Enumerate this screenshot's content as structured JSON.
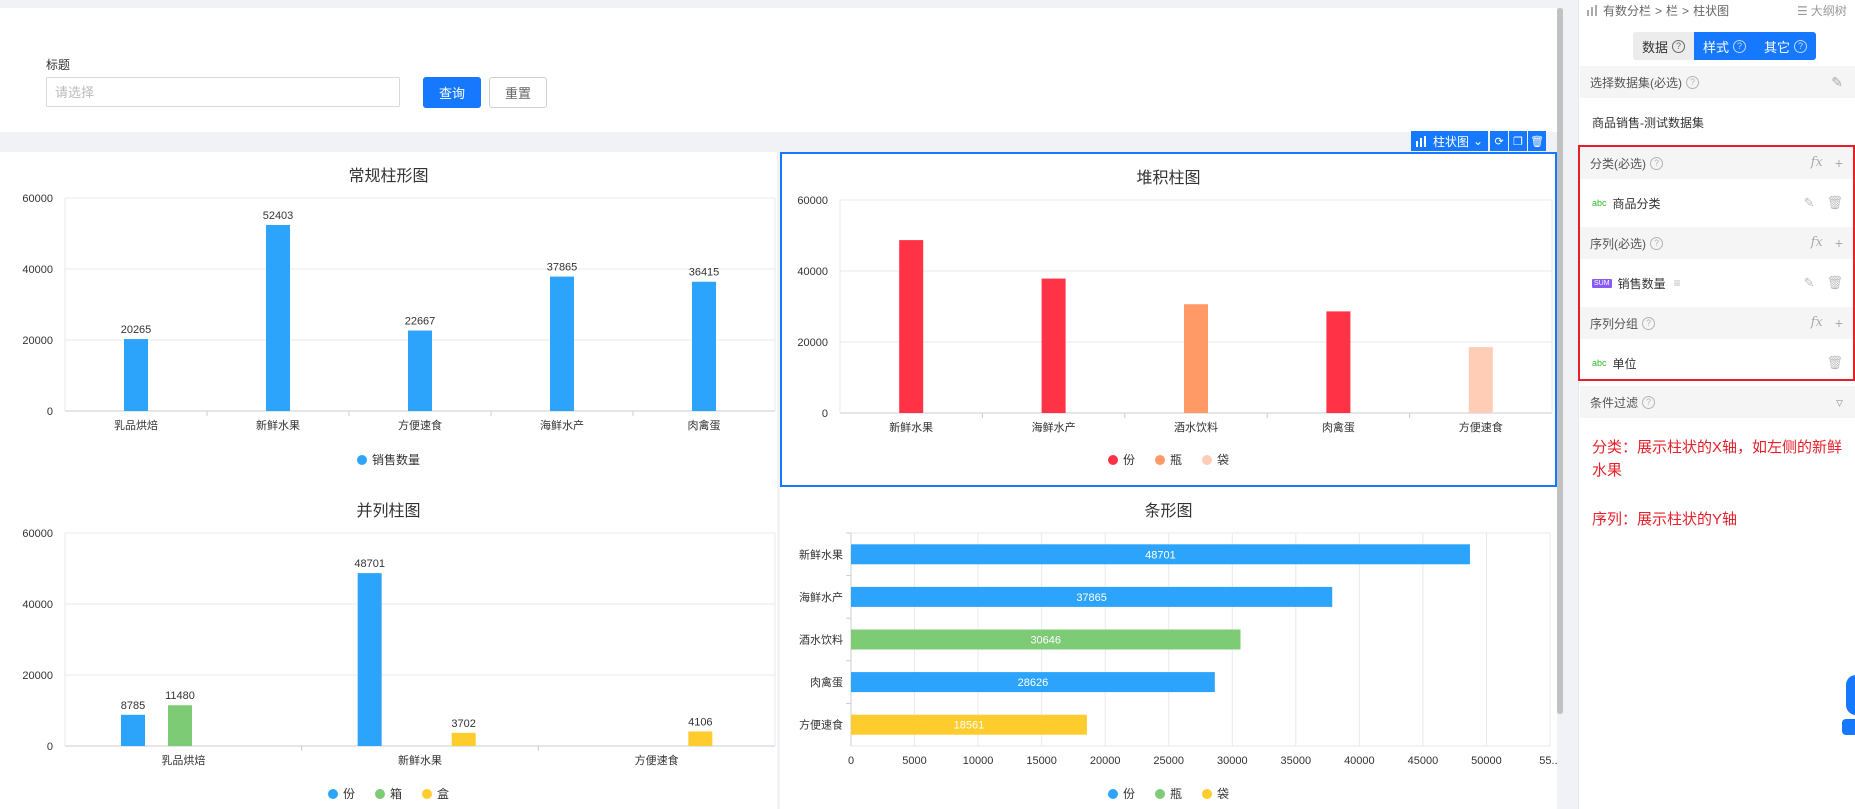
{
  "filter": {
    "label": "标题",
    "placeholder": "请选择",
    "query_label": "查询",
    "reset_label": "重置"
  },
  "toolbar": {
    "chart_type_label": "柱状图",
    "icons": [
      "bar-chart-icon",
      "chevron-down-icon",
      "refresh-icon",
      "copy-icon",
      "delete-icon"
    ]
  },
  "chart_data": [
    {
      "id": "regular",
      "type": "bar",
      "title": "常规柱形图",
      "categories": [
        "乳品烘焙",
        "新鲜水果",
        "方便速食",
        "海鲜水产",
        "肉禽蛋"
      ],
      "series": [
        {
          "name": "销售数量",
          "color": "#2da4fc",
          "values": [
            20265,
            52403,
            22667,
            37865,
            36415
          ]
        }
      ],
      "ylim": [
        0,
        60000
      ],
      "yticks": [
        0,
        20000,
        40000,
        60000
      ],
      "data_labels": true,
      "grid": true,
      "legend": "bottom-center"
    },
    {
      "id": "stacked",
      "type": "bar",
      "title": "堆积柱图",
      "categories": [
        "新鲜水果",
        "海鲜水产",
        "酒水饮料",
        "肉禽蛋",
        "方便速食"
      ],
      "bars": [
        {
          "category": "新鲜水果",
          "series": "份",
          "value": 48701
        },
        {
          "category": "海鲜水产",
          "series": "份",
          "value": 37865
        },
        {
          "category": "酒水饮料",
          "series": "瓶",
          "value": 30646
        },
        {
          "category": "肉禽蛋",
          "series": "份",
          "value": 28626
        },
        {
          "category": "方便速食",
          "series": "袋",
          "value": 18561
        }
      ],
      "series": [
        {
          "name": "份",
          "color": "#ff3345"
        },
        {
          "name": "瓶",
          "color": "#ff9966"
        },
        {
          "name": "袋",
          "color": "#ffcdb5"
        }
      ],
      "ylim": [
        0,
        60000
      ],
      "yticks": [
        0,
        20000,
        40000,
        60000
      ],
      "grid": true,
      "legend": "bottom-center"
    },
    {
      "id": "grouped",
      "type": "bar",
      "title": "并列柱图",
      "categories": [
        "乳品烘焙",
        "新鲜水果",
        "方便速食"
      ],
      "series": [
        {
          "name": "份",
          "color": "#2da4fc",
          "values": [
            8785,
            48701,
            null
          ]
        },
        {
          "name": "箱",
          "color": "#7dcb74",
          "values": [
            11480,
            null,
            null
          ]
        },
        {
          "name": "盒",
          "color": "#ffcc2e",
          "values": [
            null,
            3702,
            4106
          ]
        }
      ],
      "ylim": [
        0,
        60000
      ],
      "yticks": [
        0,
        20000,
        40000,
        60000
      ],
      "data_labels": true,
      "grid": true,
      "legend": "bottom-center"
    },
    {
      "id": "horizontal",
      "type": "bar",
      "orientation": "horizontal",
      "title": "条形图",
      "categories": [
        "新鲜水果",
        "海鲜水产",
        "酒水饮料",
        "肉禽蛋",
        "方便速食"
      ],
      "bars": [
        {
          "category": "新鲜水果",
          "series": "份",
          "value": 48701
        },
        {
          "category": "海鲜水产",
          "series": "份",
          "value": 37865
        },
        {
          "category": "酒水饮料",
          "series": "瓶",
          "value": 30646
        },
        {
          "category": "肉禽蛋",
          "series": "份",
          "value": 28626
        },
        {
          "category": "方便速食",
          "series": "袋",
          "value": 18561
        }
      ],
      "series": [
        {
          "name": "份",
          "color": "#2da4fc"
        },
        {
          "name": "瓶",
          "color": "#7dcb74"
        },
        {
          "name": "袋",
          "color": "#ffcc2e"
        }
      ],
      "xlim": [
        0,
        55000
      ],
      "xticks": [
        "0",
        "5000",
        "10000",
        "15000",
        "20000",
        "25000",
        "30000",
        "35000",
        "40000",
        "45000",
        "50000",
        "55..."
      ],
      "data_labels": true,
      "grid": true,
      "legend": "bottom-center"
    }
  ],
  "panel": {
    "breadcrumb": [
      "有数分栏",
      "栏",
      "柱状图"
    ],
    "outline_label": "大纲树",
    "tabs": [
      "数据",
      "样式",
      "其它"
    ],
    "dataset": {
      "label": "选择数据集(必选)",
      "value": "商品销售-测试数据集"
    },
    "category": {
      "label": "分类(必选)",
      "field": "商品分类",
      "field_type": "abc"
    },
    "series": {
      "label": "序列(必选)",
      "field": "销售数量",
      "field_type": "SUM"
    },
    "series_group": {
      "label": "序列分组",
      "field": "单位",
      "field_type": "abc"
    },
    "filter": {
      "label": "条件过滤"
    },
    "fx_label": "fx"
  },
  "notes": {
    "category_note": "分类：展示柱状的X轴，如左侧的新鲜水果",
    "series_note": "序列：展示柱状的Y轴"
  },
  "colors": {
    "accent": "#1677ff",
    "annotation": "#e5202a"
  }
}
